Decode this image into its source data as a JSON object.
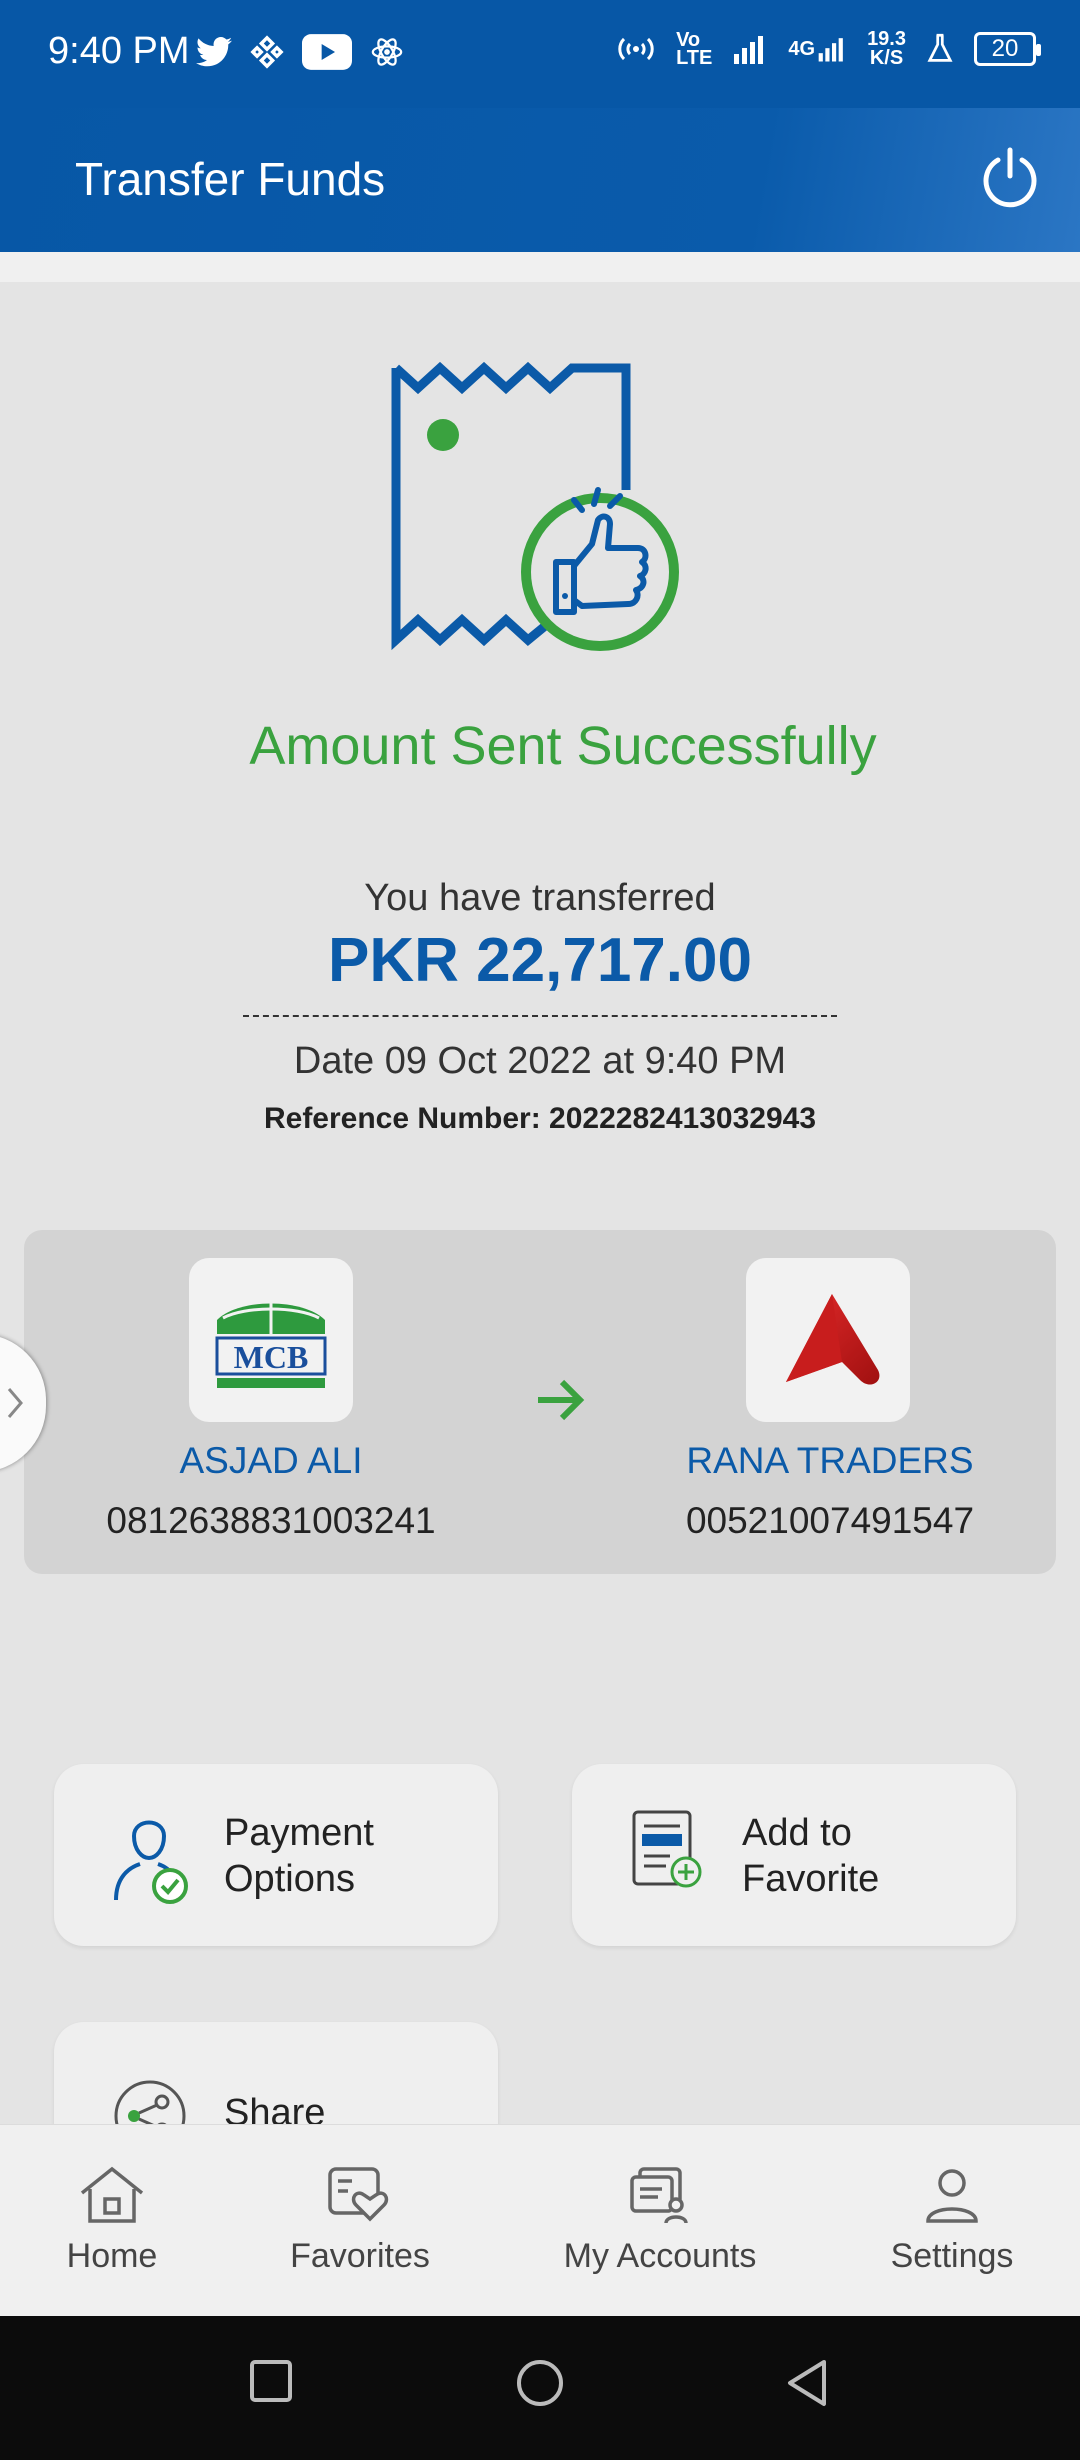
{
  "status_bar": {
    "time": "9:40 PM",
    "left_icons": [
      "twitter-icon",
      "binance-icon",
      "youtube-icon",
      "react-icon"
    ],
    "network_speed_value": "19.3",
    "network_speed_unit": "K/S",
    "volte_top": "Vo",
    "volte_bottom": "LTE",
    "network_type": "4G",
    "battery": "20"
  },
  "header": {
    "title": "Transfer Funds",
    "power_icon": "power-icon"
  },
  "receipt": {
    "status_title": "Amount Sent Successfully",
    "transfer_label": "You have transferred",
    "amount": "PKR 22,717.00",
    "date": "Date 09 Oct 2022 at 9:40 PM",
    "reference": "Reference Number: 2022282413032943"
  },
  "transfer": {
    "from": {
      "bank_logo": "MCB",
      "name": "ASJAD ALI",
      "account": "0812638831003241"
    },
    "to": {
      "bank_logo": "red-arrow-logo",
      "name": "RANA TRADERS",
      "account": "00521007491547"
    }
  },
  "actions": {
    "payment_options": "Payment\nOptions",
    "add_to_favorite": "Add to\nFavorite",
    "share": "Share"
  },
  "bottom_nav": {
    "home": "Home",
    "favorites": "Favorites",
    "my_accounts": "My Accounts",
    "settings": "Settings"
  },
  "colors": {
    "brand_blue": "#0757a6",
    "success_green": "#3aa23f",
    "background": "#e4e4e4"
  }
}
